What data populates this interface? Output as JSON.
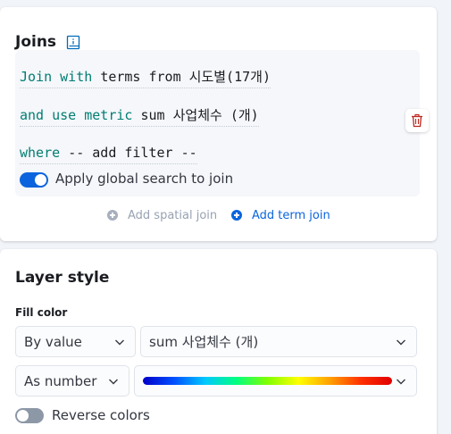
{
  "joins": {
    "title": "Joins",
    "join_keyword": "Join",
    "with_keyword": "with",
    "join_value": "terms from 시도별(17개)",
    "and_use_metric_keyword": "and use metric",
    "metric_value": "sum 사업체수 (개)",
    "where_keyword": "where",
    "where_value": "-- add filter --",
    "global_search_label": "Apply global search to join",
    "global_search_enabled": true,
    "add_spatial_join_label": "Add spatial join",
    "add_term_join_label": "Add term join"
  },
  "layer_style": {
    "title": "Layer style",
    "fill_color_label": "Fill color",
    "color_by": "By value",
    "field": "sum 사업체수 (개)",
    "format": "As number",
    "color_ramp": "rainbow",
    "reverse_colors_label": "Reverse colors",
    "reverse_colors_enabled": false
  },
  "colors": {
    "accent": "#0b64dd",
    "keyword": "#017d73",
    "trash": "#bd271e",
    "disabled": "#98a2b3"
  },
  "icons": {
    "documentation": "book-icon",
    "remove_join": "trash-icon",
    "add": "plus-in-circle-icon",
    "dropdown": "chevron-down-icon"
  }
}
